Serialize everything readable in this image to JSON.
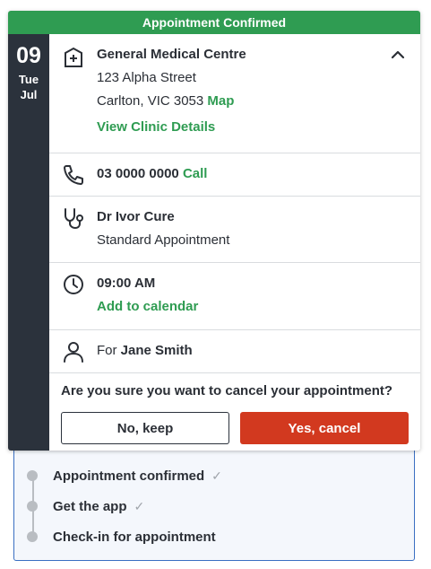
{
  "banner": "Appointment Confirmed",
  "date": {
    "day": "09",
    "weekday": "Tue",
    "month": "Jul"
  },
  "clinic": {
    "name": "General Medical Centre",
    "street": "123 Alpha Street",
    "suburb": "Carlton, VIC 3053",
    "map_link": "Map",
    "details_link": "View Clinic Details"
  },
  "phone": {
    "number": "03 0000 0000",
    "call_link": "Call"
  },
  "doctor": {
    "name": "Dr Ivor Cure",
    "type": "Standard Appointment"
  },
  "time": {
    "value": "09:00 AM",
    "calendar_link": "Add to calendar"
  },
  "patient": {
    "prefix": "For",
    "name": "Jane Smith"
  },
  "confirm": {
    "question": "Are you sure you want to cancel your appointment?",
    "keep_label": "No, keep",
    "cancel_label": "Yes, cancel"
  },
  "steps": [
    {
      "label": "Appointment confirmed",
      "check": "✓"
    },
    {
      "label": "Get the app",
      "check": "✓"
    },
    {
      "label": "Check-in for appointment",
      "check": ""
    }
  ],
  "colors": {
    "accent": "#2f9c52",
    "danger": "#d2391f",
    "sidebar": "#2b323c",
    "panel_border": "#3a6fc2"
  }
}
